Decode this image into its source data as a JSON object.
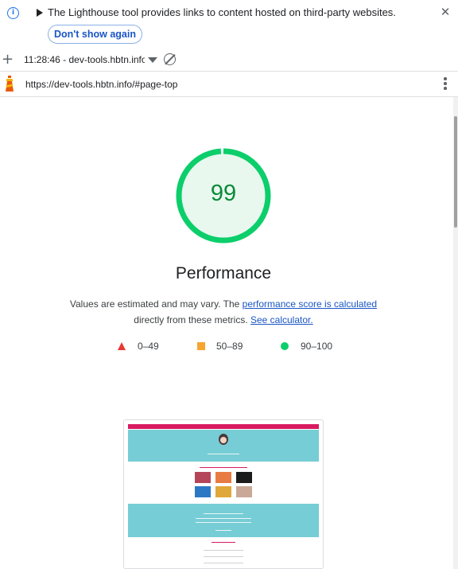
{
  "infobar": {
    "message": "The Lighthouse tool provides links to content hosted on third-party websites.",
    "dont_show_label": "Don't show again"
  },
  "toolbar": {
    "report_label": "11:28:46 - dev-tools.hbtn.info"
  },
  "urlbar": {
    "url": "https://dev-tools.hbtn.info/#page-top"
  },
  "performance": {
    "score": "99",
    "title": "Performance",
    "desc_part1": "Values are estimated and may vary. The ",
    "desc_link1": "performance score is calculated",
    "desc_part2": "directly from these metrics. ",
    "desc_link2": "See calculator.",
    "score_fraction": 0.99
  },
  "legend": {
    "fail": "0–49",
    "average": "50–89",
    "pass": "90–100"
  },
  "colors": {
    "pass": "#0cce6b",
    "average": "#f5a530",
    "fail": "#e53935",
    "link": "#1a56c4"
  },
  "icons": [
    "info-icon",
    "expand-arrow-icon",
    "close-icon",
    "plus-icon",
    "dropdown-caret-icon",
    "clear-icon",
    "lighthouse-icon",
    "more-vert-icon"
  ]
}
